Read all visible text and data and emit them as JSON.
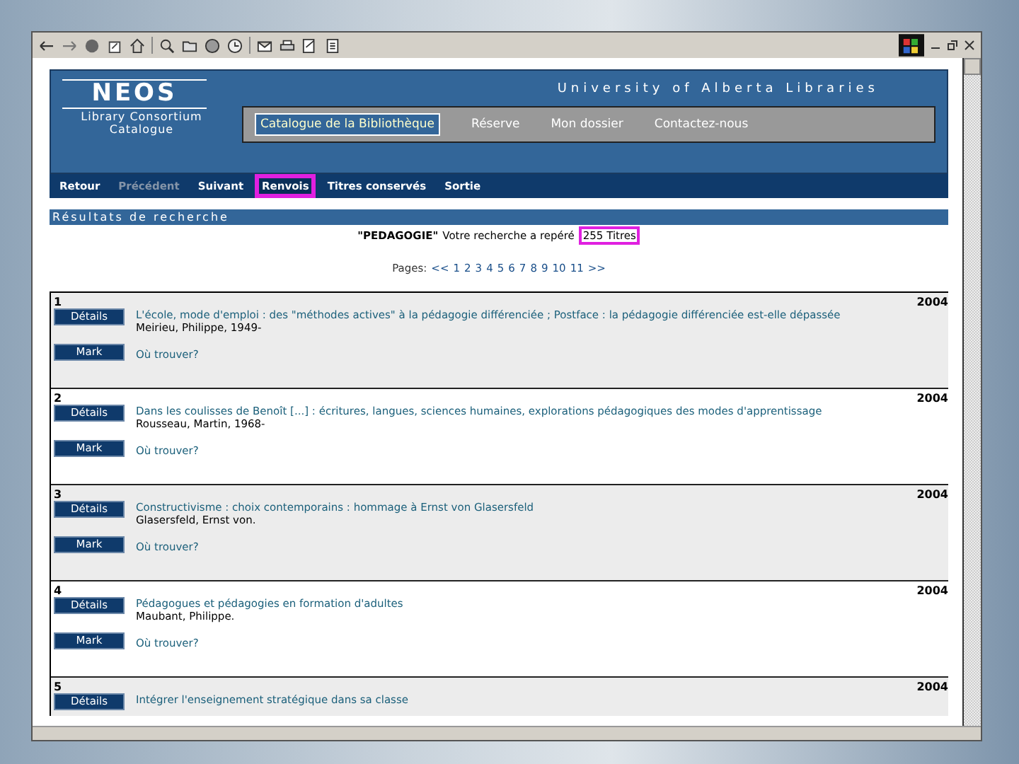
{
  "header": {
    "logo": "NEOS",
    "logo_subtitle": [
      "Library Consortium",
      "Catalogue"
    ],
    "institution": "University of Alberta Libraries"
  },
  "tabs": [
    {
      "label": "Catalogue de la Bibliothèque",
      "selected": true
    },
    {
      "label": "Réserve",
      "selected": false
    },
    {
      "label": "Mon dossier",
      "selected": false
    },
    {
      "label": "Contactez-nous",
      "selected": false
    }
  ],
  "nav": [
    {
      "label": "Retour",
      "disabled": false,
      "highlighted": false
    },
    {
      "label": "Précédent",
      "disabled": true,
      "highlighted": false
    },
    {
      "label": "Suivant",
      "disabled": false,
      "highlighted": false
    },
    {
      "label": "Renvois",
      "disabled": false,
      "highlighted": true
    },
    {
      "label": "Titres conservés",
      "disabled": false,
      "highlighted": false
    },
    {
      "label": "Sortie",
      "disabled": false,
      "highlighted": false
    }
  ],
  "results": {
    "heading": "Résultats de recherche",
    "query": "\"PEDAGOGIE\"",
    "message": "Votre recherche a repéré",
    "count": "255 Titres",
    "count_highlighted": true,
    "pages_label": "Pages:",
    "pages": [
      "<<",
      "1",
      "2",
      "3",
      "4",
      "5",
      "6",
      "7",
      "8",
      "9",
      "10",
      "11",
      ">>"
    ]
  },
  "records": [
    {
      "number": "1",
      "year": "2004",
      "title": "L'école, mode d'emploi : des \"méthodes actives\" à la pédagogie différenciée ; Postface : la pédagogie différenciée est-elle dépassée",
      "author": "Meirieu, Philippe, 1949-",
      "buttons": [
        "Détails",
        "Mark"
      ],
      "link": "Où trouver?"
    },
    {
      "number": "2",
      "year": "2004",
      "title": "Dans les coulisses de Benoît [...] : écritures, langues, sciences humaines, explorations pédagogiques des modes d'apprentissage",
      "author": "Rousseau, Martin, 1968-",
      "buttons": [
        "Détails",
        "Mark"
      ],
      "link": "Où trouver?"
    },
    {
      "number": "3",
      "year": "2004",
      "title": "Constructivisme : choix contemporains : hommage à Ernst von Glasersfeld",
      "author": "Glasersfeld, Ernst von.",
      "buttons": [
        "Détails",
        "Mark"
      ],
      "link": "Où trouver?"
    },
    {
      "number": "4",
      "year": "2004",
      "title": "Pédagogues et pédagogies en formation d'adultes",
      "author": "Maubant, Philippe.",
      "buttons": [
        "Détails",
        "Mark"
      ],
      "link": "Où trouver?"
    },
    {
      "number": "5",
      "year": "2004",
      "title": "Intégrer l'enseignement stratégique dans sa classe",
      "buttons": [
        "Détails"
      ]
    }
  ]
}
